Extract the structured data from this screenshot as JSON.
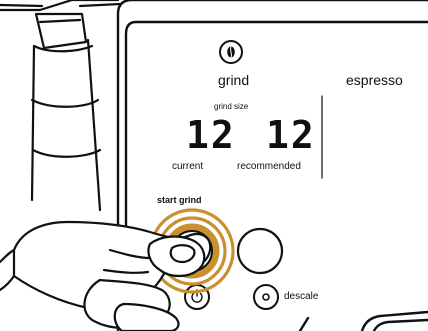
{
  "panel": {
    "mode": {
      "label": "grind",
      "icon": "coffee-bean-icon"
    },
    "secondary_mode": {
      "label": "espresso"
    },
    "grind_size": {
      "title": "grind size",
      "current_value": "12",
      "current_label": "current",
      "recommended_value": "12",
      "recommended_label": "recommended"
    },
    "start_grind": {
      "label": "start grind",
      "accent_color": "#c8902e"
    },
    "power": {
      "icon": "power-icon"
    },
    "descale": {
      "label": "descale",
      "icon": "dot-circle-icon"
    }
  },
  "colors": {
    "outline": "#111111",
    "accent": "#c8902e",
    "background": "#ffffff"
  }
}
